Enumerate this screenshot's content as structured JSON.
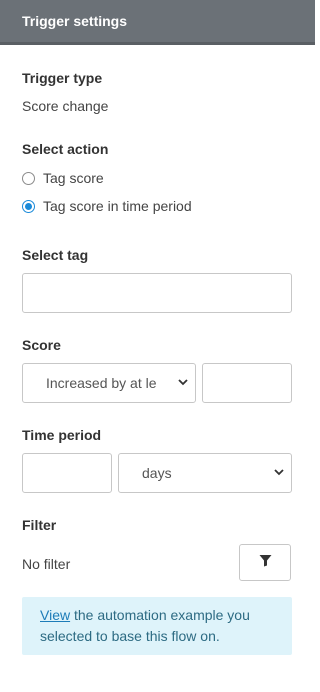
{
  "header": {
    "title": "Trigger settings"
  },
  "trigger_type": {
    "label": "Trigger type",
    "value": "Score change"
  },
  "select_action": {
    "label": "Select action",
    "options": [
      {
        "label": "Tag score",
        "checked": false
      },
      {
        "label": "Tag score in time period",
        "checked": true
      }
    ]
  },
  "select_tag": {
    "label": "Select tag",
    "value": ""
  },
  "score": {
    "label": "Score",
    "operator": "Increased by at le",
    "amount": ""
  },
  "time_period": {
    "label": "Time period",
    "amount": "",
    "unit": "days"
  },
  "filter": {
    "label": "Filter",
    "value": "No filter",
    "button_icon": "funnel-icon"
  },
  "info": {
    "link_text": "View",
    "line1_rest": " the automation example you",
    "line2": "selected to base this flow on."
  },
  "colors": {
    "header_bg": "#6b7177",
    "accent": "#1a8ad9",
    "info_bg": "#def3fa"
  }
}
